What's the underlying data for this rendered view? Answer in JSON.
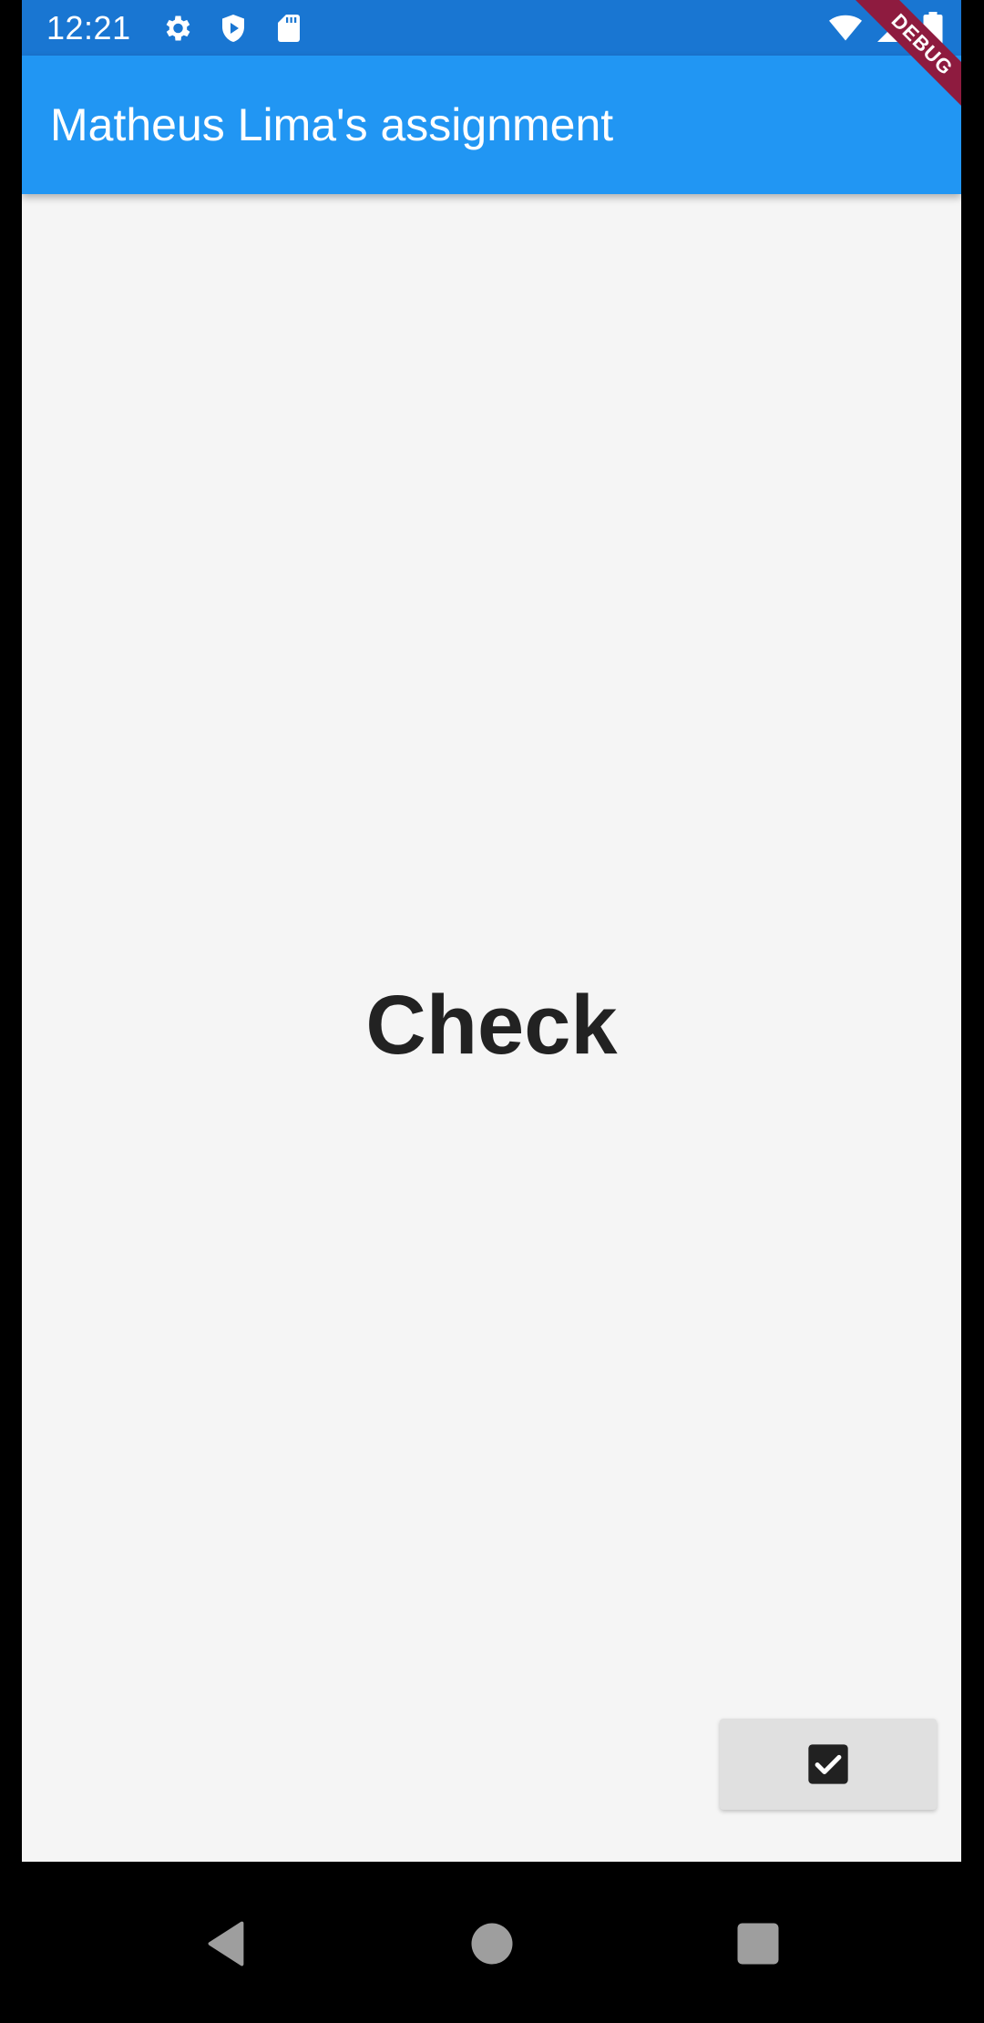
{
  "status_bar": {
    "time": "12:21",
    "icons": [
      "settings-icon",
      "shield-play-icon",
      "sd-card-icon",
      "wifi-icon",
      "signal-icon",
      "battery-icon"
    ]
  },
  "app_bar": {
    "title": "Matheus Lima's assignment",
    "color": "#2196f3"
  },
  "debug_banner": {
    "label": "DEBUG"
  },
  "main": {
    "label": "Check"
  },
  "fab": {
    "icon": "check-box-icon"
  },
  "nav_bar": {
    "buttons": [
      "back-icon",
      "home-icon",
      "recents-icon"
    ]
  }
}
